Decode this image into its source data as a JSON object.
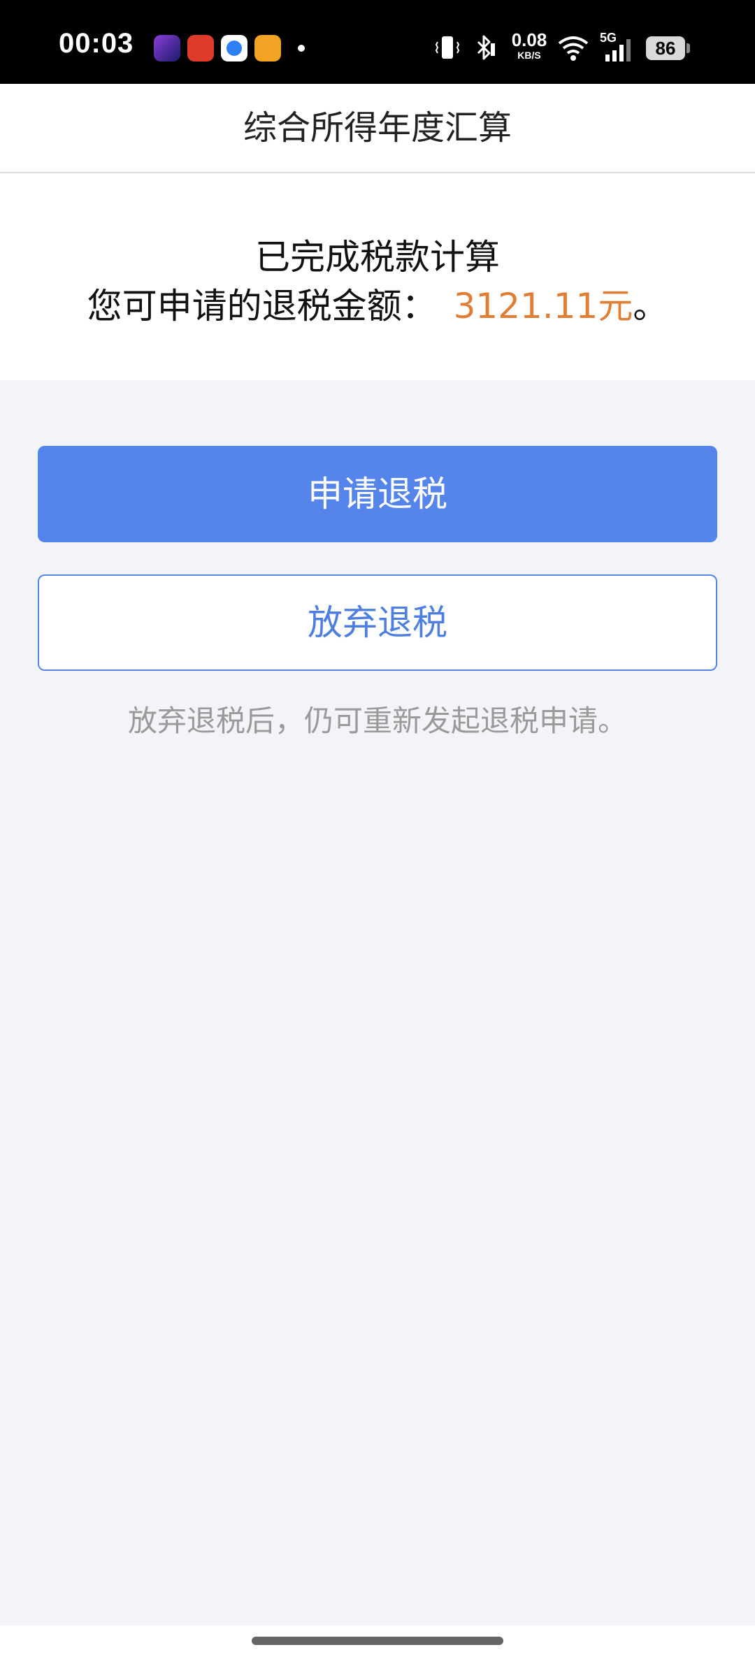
{
  "status_bar": {
    "time": "00:03",
    "net_speed_value": "0.08",
    "net_speed_unit": "KB/S",
    "network_type": "5G",
    "battery": "86",
    "icons": [
      "vibrate-icon",
      "bluetooth-icon",
      "wifi-icon",
      "signal-icon"
    ]
  },
  "header": {
    "title": "综合所得年度汇算"
  },
  "result": {
    "line1": "已完成税款计算",
    "line2_prefix": "您可申请的退税金额：",
    "amount": "3121.11元",
    "line2_suffix": "。"
  },
  "actions": {
    "apply_label": "申请退税",
    "abandon_label": "放弃退税"
  },
  "hint": "放弃退税后，仍可重新发起退税申请。",
  "colors": {
    "primary": "#5585ea",
    "amount": "#e07e35",
    "background": "#f2f4f8"
  }
}
